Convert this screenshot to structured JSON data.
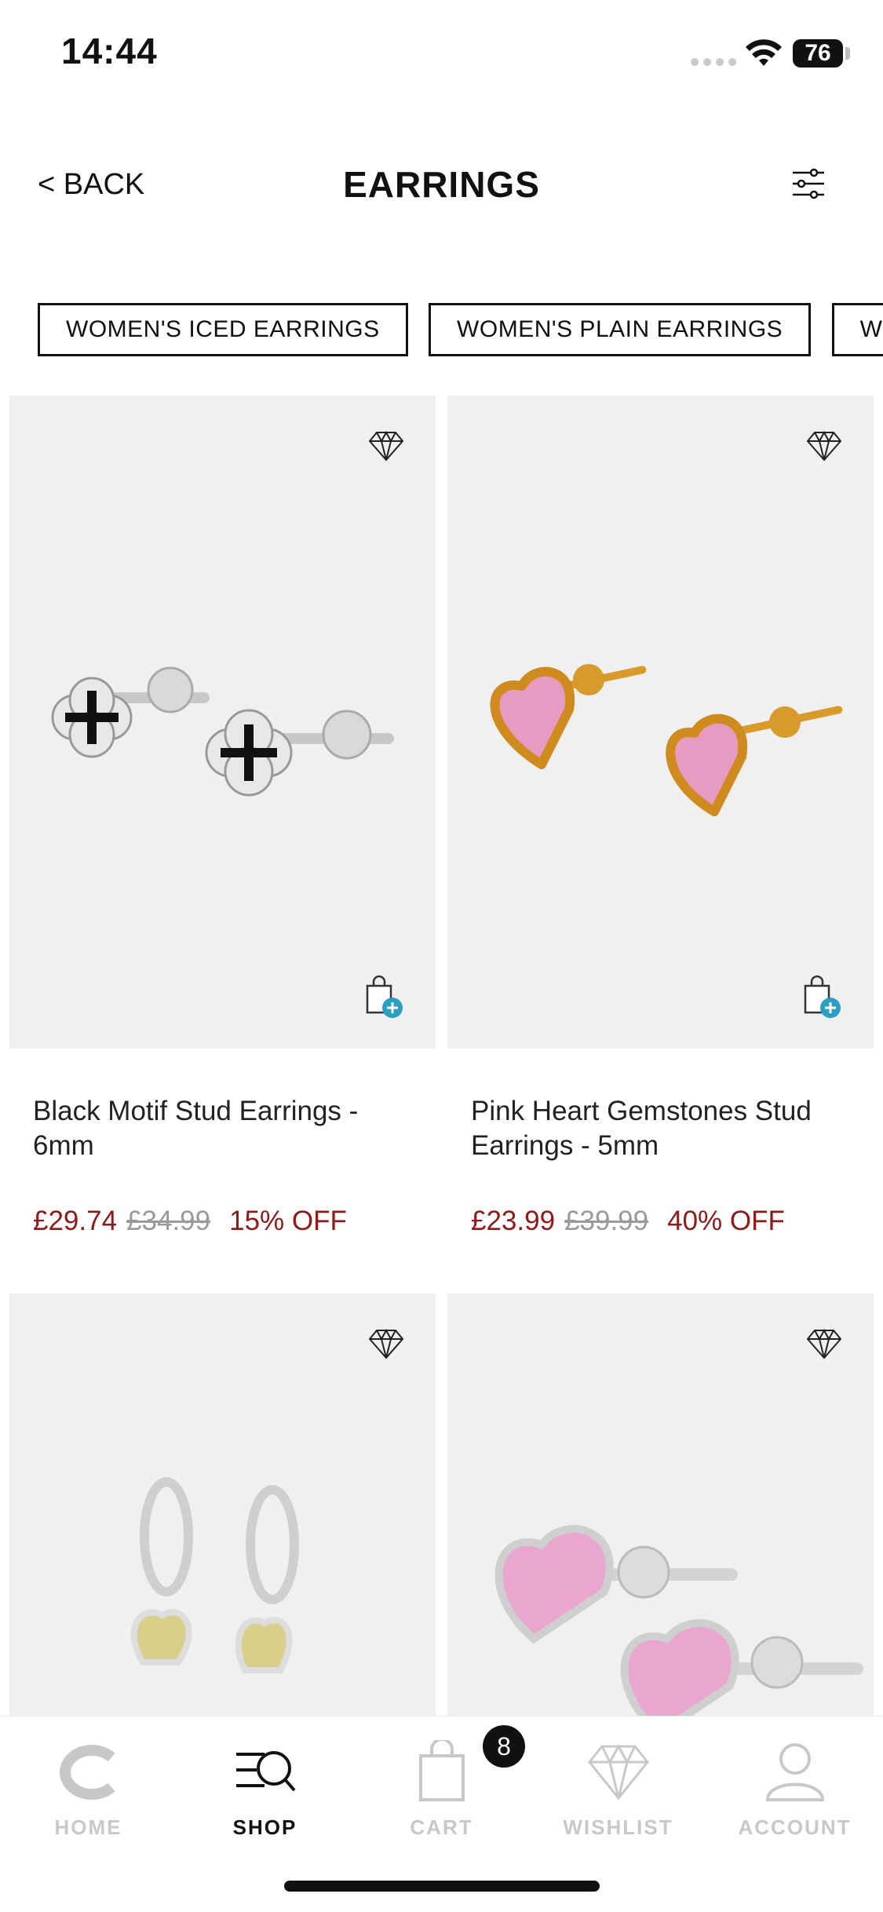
{
  "status_bar": {
    "time": "14:44",
    "battery": "76"
  },
  "header": {
    "back_label": "< BACK",
    "title": "EARRINGS"
  },
  "categories": [
    "WOMEN'S ICED EARRINGS",
    "WOMEN'S PLAIN EARRINGS",
    "WOMEN'S"
  ],
  "products": [
    {
      "name": "Black Motif Stud Earrings - 6mm",
      "price": "£29.74",
      "original_price": "£34.99",
      "discount": "15% OFF"
    },
    {
      "name": "Pink Heart Gemstones Stud Earrings - 5mm",
      "price": "£23.99",
      "original_price": "£39.99",
      "discount": "40% OFF"
    },
    {
      "name": "",
      "price": "",
      "original_price": "",
      "discount": ""
    },
    {
      "name": "",
      "price": "",
      "original_price": "",
      "discount": ""
    }
  ],
  "bottom_nav": {
    "items": [
      {
        "label": "HOME",
        "icon": "home-logo-icon",
        "active": false
      },
      {
        "label": "SHOP",
        "icon": "shop-search-icon",
        "active": true
      },
      {
        "label": "CART",
        "icon": "shopping-bag-icon",
        "active": false
      },
      {
        "label": "WISHLIST",
        "icon": "diamond-icon",
        "active": false
      },
      {
        "label": "ACCOUNT",
        "icon": "user-icon",
        "active": false
      }
    ],
    "cart_count": "8"
  },
  "colors": {
    "sale_red": "#8e1a1a",
    "image_bg": "#f0f0f0",
    "accent_blue": "#2a9fc1"
  }
}
